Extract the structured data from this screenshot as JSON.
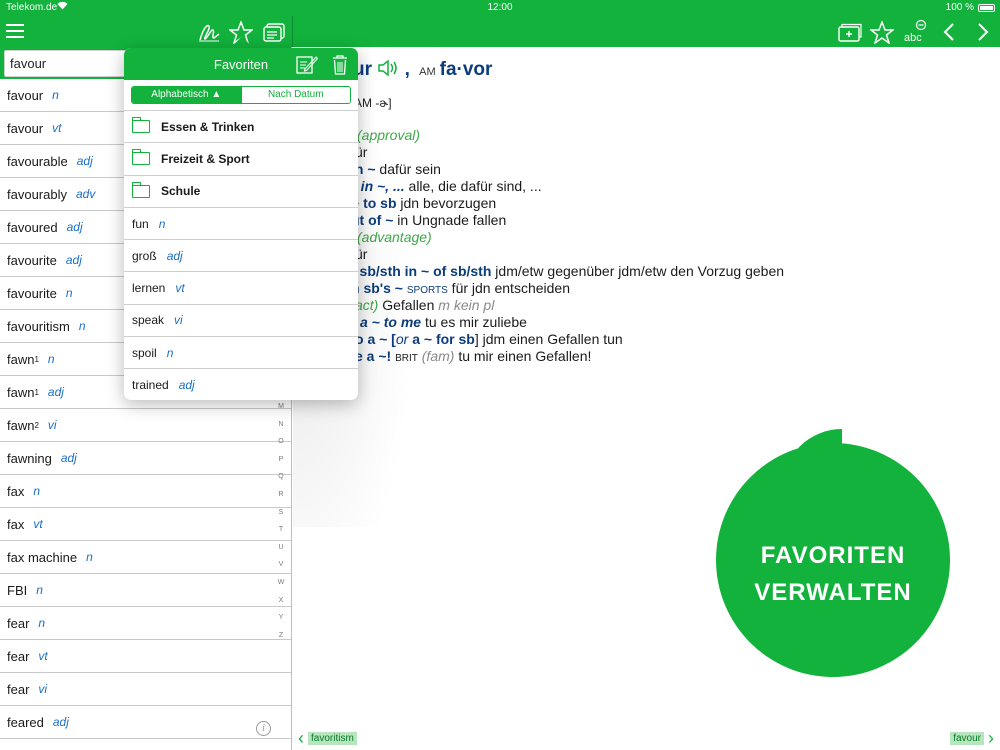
{
  "status_bar": {
    "carrier": "Telekom.de",
    "time": "12:00",
    "battery": "100 %"
  },
  "toolbar": {
    "left_icons": [
      "menu-icon",
      "handwriting-icon",
      "favorites-star-icon",
      "flashcards-icon"
    ],
    "right_icons": [
      "add-card-icon",
      "favorite-star-icon",
      "font-size-icon",
      "back-chevron-icon",
      "forward-chevron-icon"
    ],
    "font_size_label": "abc"
  },
  "search": {
    "value": "favour"
  },
  "word_list": [
    {
      "word": "favour",
      "sup": "",
      "pos": "n"
    },
    {
      "word": "favour",
      "sup": "",
      "pos": "vt"
    },
    {
      "word": "favourable",
      "sup": "",
      "pos": "adj"
    },
    {
      "word": "favourably",
      "sup": "",
      "pos": "adv"
    },
    {
      "word": "favoured",
      "sup": "",
      "pos": "adj"
    },
    {
      "word": "favourite",
      "sup": "",
      "pos": "adj"
    },
    {
      "word": "favourite",
      "sup": "",
      "pos": "n"
    },
    {
      "word": "favouritism",
      "sup": "",
      "pos": "n"
    },
    {
      "word": "fawn",
      "sup": "1",
      "pos": "n"
    },
    {
      "word": "fawn",
      "sup": "1",
      "pos": "adj"
    },
    {
      "word": "fawn",
      "sup": "2",
      "pos": "vi"
    },
    {
      "word": "fawning",
      "sup": "",
      "pos": "adj"
    },
    {
      "word": "fax",
      "sup": "",
      "pos": "n"
    },
    {
      "word": "fax",
      "sup": "",
      "pos": "vt"
    },
    {
      "word": "fax machine",
      "sup": "",
      "pos": "n"
    },
    {
      "word": "FBI",
      "sup": "",
      "pos": "n"
    },
    {
      "word": "fear",
      "sup": "",
      "pos": "n"
    },
    {
      "word": "fear",
      "sup": "",
      "pos": "vt"
    },
    {
      "word": "fear",
      "sup": "",
      "pos": "vi"
    },
    {
      "word": "feared",
      "sup": "",
      "pos": "adj"
    }
  ],
  "alpha_index": [
    "M",
    "N",
    "O",
    "P",
    "Q",
    "R",
    "S",
    "T",
    "U",
    "V",
    "W",
    "X",
    "Y",
    "Z"
  ],
  "favorites_popover": {
    "title": "Favoriten",
    "sort_alpha": "Alphabetisch ▲",
    "sort_date": "Nach Datum",
    "folders": [
      "Essen & Trinken",
      "Freizeit & Sport",
      "Schule"
    ],
    "items": [
      {
        "word": "fun",
        "pos": "n"
      },
      {
        "word": "groß",
        "pos": "adj"
      },
      {
        "word": "lernen",
        "pos": "vt"
      },
      {
        "word": "speak",
        "pos": "vi"
      },
      {
        "word": "spoil",
        "pos": "n"
      },
      {
        "word": "trained",
        "pos": "adj"
      }
    ]
  },
  "entry": {
    "head_partial": "ur",
    "am_label": "AM",
    "am_form": "fa·vor",
    "pron": "AM -ɚ]",
    "lines": {
      "l1_sense": "(approval)",
      "l2": "ür",
      "l3_b": "in ~",
      "l3_t": " dafür sein",
      "l4_b": "e in ~, ...",
      "l4_t": " alle, die dafür sind, ...",
      "l5_b": "~ to sb",
      "l5_t": " jdn bevorzugen",
      "l6_b": "ut of ~",
      "l6_t": " in Ungnade fallen",
      "l7_sense": "(advantage)",
      "l8": "ür",
      "l9_b": "t sb/sth in ~ of sb/sth",
      "l9_t": " jdm/etw gegenüber jdm/etw den Vorzug geben",
      "l10_b": "n sb's ~",
      "l10_label": "SPORTS",
      "l10_t": " für jdn entscheiden",
      "l11_sense": "act)",
      "l11_t": " Gefallen ",
      "l11_gram": "m kein pl",
      "l12_b": "a ~ to me",
      "l12_t": " tu es mir zuliebe",
      "l13_b1": "o a ~ [",
      "l13_or": "or",
      "l13_b2": " a ~ for sb",
      "l13_t": "] jdm einen Gefallen tun",
      "l14_b": "e a ~!",
      "l14_brit": "BRIT",
      "l14_fam": " (fam)",
      "l14_t": " tu mir einen Gefallen!"
    }
  },
  "bottom_nav": {
    "prev": "favoritism",
    "next": "favour"
  },
  "bubble": {
    "line1": "FAVORITEN",
    "line2": "VERWALTEN"
  },
  "colors": {
    "brand_green": "#12b23c",
    "headword_blue": "#0b3c7c",
    "pos_blue": "#1a6fc6"
  }
}
